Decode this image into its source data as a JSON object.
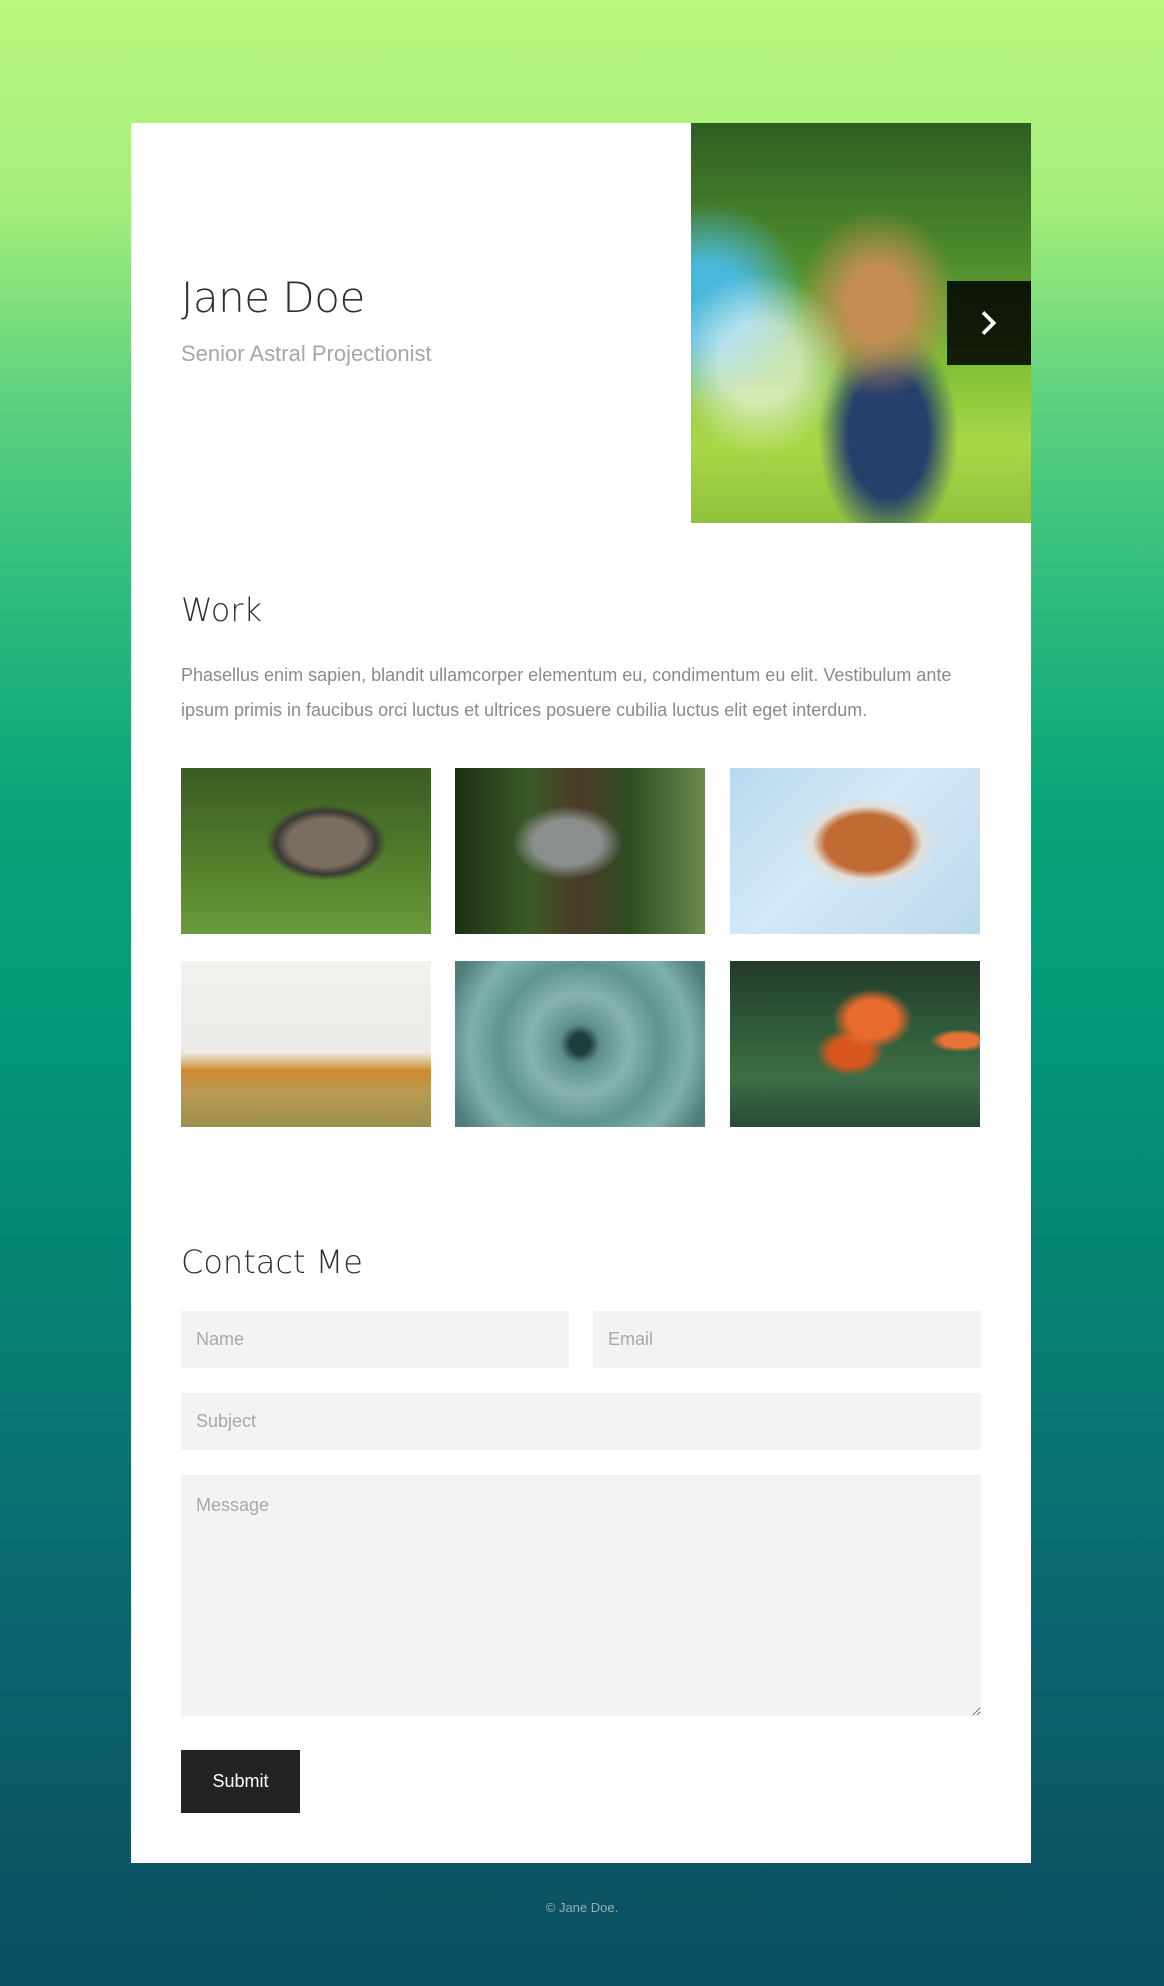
{
  "intro": {
    "name": "Jane Doe",
    "subtitle": "Senior Astral Projectionist"
  },
  "hero": {
    "next_icon": "chevron-right-icon"
  },
  "work": {
    "title": "Work",
    "description": "Phasellus enim sapien, blandit ullamcorper elementum eu, condimentum eu elit. Vestibulum ante ipsum primis in faucibus orci luctus et ultrices posuere cubilia luctus elit eget interdum."
  },
  "contact": {
    "title": "Contact Me",
    "name_placeholder": "Name",
    "email_placeholder": "Email",
    "subject_placeholder": "Subject",
    "message_placeholder": "Message",
    "submit_label": "Submit"
  },
  "footer": {
    "text": "© Jane Doe."
  }
}
